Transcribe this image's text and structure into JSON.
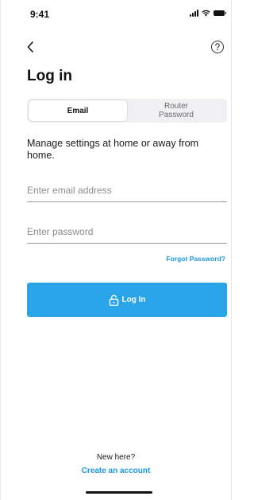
{
  "status_bar": {
    "time": "9:41",
    "icons": [
      "signal-icon",
      "wifi-icon",
      "battery-icon"
    ]
  },
  "nav": {
    "back_icon": "chevron-left-icon",
    "help_icon": "question-circle-icon"
  },
  "title": "Log in",
  "tabs": [
    {
      "label": "Email",
      "active": true
    },
    {
      "label": "Router\nPassword",
      "active": false
    }
  ],
  "description": "Manage settings at home or away from home.",
  "form": {
    "email_placeholder": "Enter email address",
    "email_value": "",
    "password_placeholder": "Enter password",
    "password_value": ""
  },
  "forgot_password": "Forgot Password?",
  "login_button": {
    "label": "Log In",
    "icon": "lock-open-icon"
  },
  "footer": {
    "new_here": "New here?",
    "create_account": "Create an account"
  },
  "colors": {
    "accent": "#2aa4e8",
    "link": "#1a98e0",
    "segment_bg": "#f0f0f2"
  }
}
